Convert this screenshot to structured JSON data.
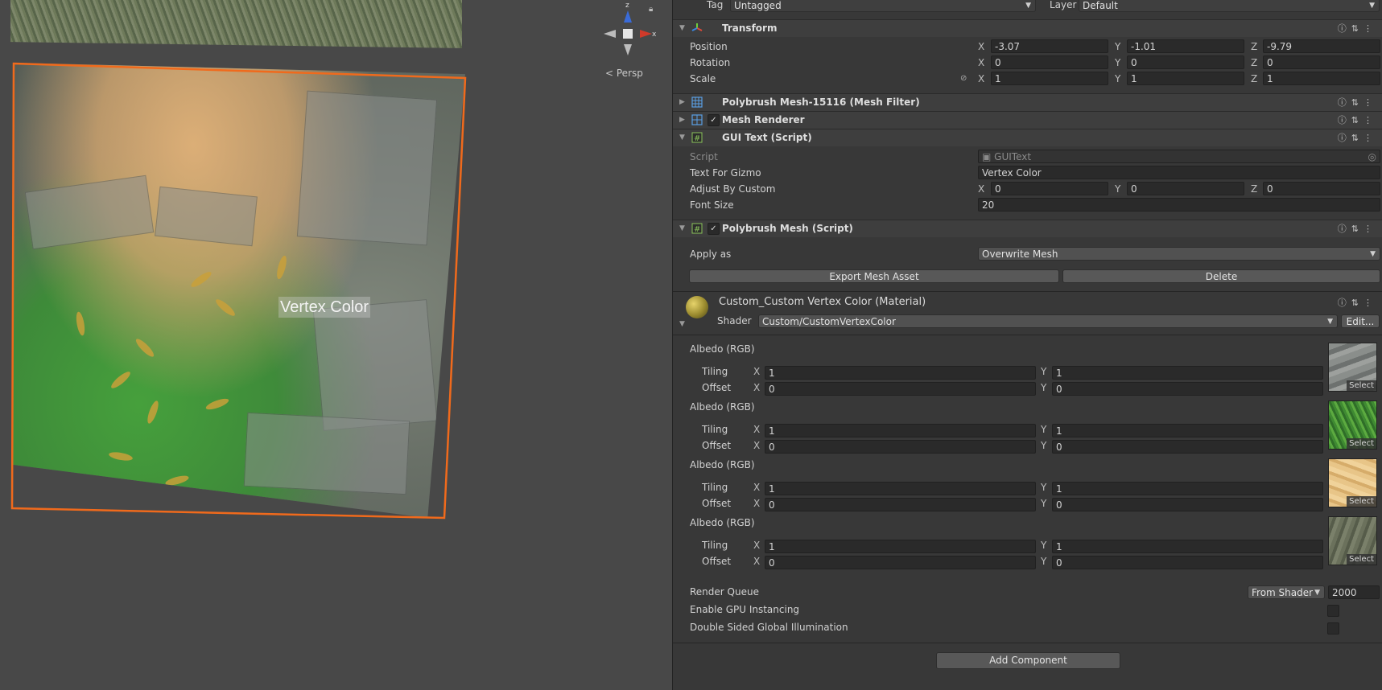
{
  "scene": {
    "gizmo_text": "Vertex Color",
    "persp_label": "Persp",
    "axes": {
      "x": "x",
      "y": "y",
      "z": "z"
    }
  },
  "header": {
    "tag_label": "Tag",
    "tag_value": "Untagged",
    "layer_label": "Layer",
    "layer_value": "Default"
  },
  "transform": {
    "title": "Transform",
    "rows": [
      {
        "label": "Position",
        "x": "-3.07",
        "y": "-1.01",
        "z": "-9.79"
      },
      {
        "label": "Rotation",
        "x": "0",
        "y": "0",
        "z": "0"
      },
      {
        "label": "Scale",
        "x": "1",
        "y": "1",
        "z": "1"
      }
    ]
  },
  "mesh_filter": {
    "title": "Polybrush Mesh-15116 (Mesh Filter)"
  },
  "mesh_renderer": {
    "title": "Mesh Renderer"
  },
  "gui_text": {
    "title": "GUI Text (Script)",
    "script_label": "Script",
    "script_value": "GUIText",
    "text_label": "Text For Gizmo",
    "text_value": "Vertex Color",
    "adjust_label": "Adjust By Custom",
    "adjust": {
      "x": "0",
      "y": "0",
      "z": "0"
    },
    "font_label": "Font Size",
    "font_value": "20"
  },
  "polybrush": {
    "title": "Polybrush Mesh (Script)",
    "apply_label": "Apply as",
    "apply_value": "Overwrite Mesh",
    "export_button": "Export Mesh Asset",
    "delete_button": "Delete"
  },
  "material": {
    "title": "Custom_Custom Vertex Color (Material)",
    "shader_label": "Shader",
    "shader_value": "Custom/CustomVertexColor",
    "edit_button": "Edit...",
    "albedo_label": "Albedo (RGB)",
    "tiling_label": "Tiling",
    "offset_label": "Offset",
    "select_label": "Select",
    "layers": [
      {
        "tiling_x": "1",
        "tiling_y": "1",
        "offset_x": "0",
        "offset_y": "0",
        "thumb": "rock"
      },
      {
        "tiling_x": "1",
        "tiling_y": "1",
        "offset_x": "0",
        "offset_y": "0",
        "thumb": "grass"
      },
      {
        "tiling_x": "1",
        "tiling_y": "1",
        "offset_x": "0",
        "offset_y": "0",
        "thumb": "sand"
      },
      {
        "tiling_x": "1",
        "tiling_y": "1",
        "offset_x": "0",
        "offset_y": "0",
        "thumb": "moss"
      }
    ],
    "render_queue_label": "Render Queue",
    "render_queue_mode": "From Shader",
    "render_queue_value": "2000",
    "gpu_label": "Enable GPU Instancing",
    "dsgi_label": "Double Sided Global Illumination"
  },
  "add_component": "Add Component",
  "axis_letters": {
    "x": "X",
    "y": "Y",
    "z": "Z"
  },
  "colors": {
    "selection_outline": "#f06a1c",
    "inspector_bg": "#383838",
    "scene_bg": "#484848"
  }
}
